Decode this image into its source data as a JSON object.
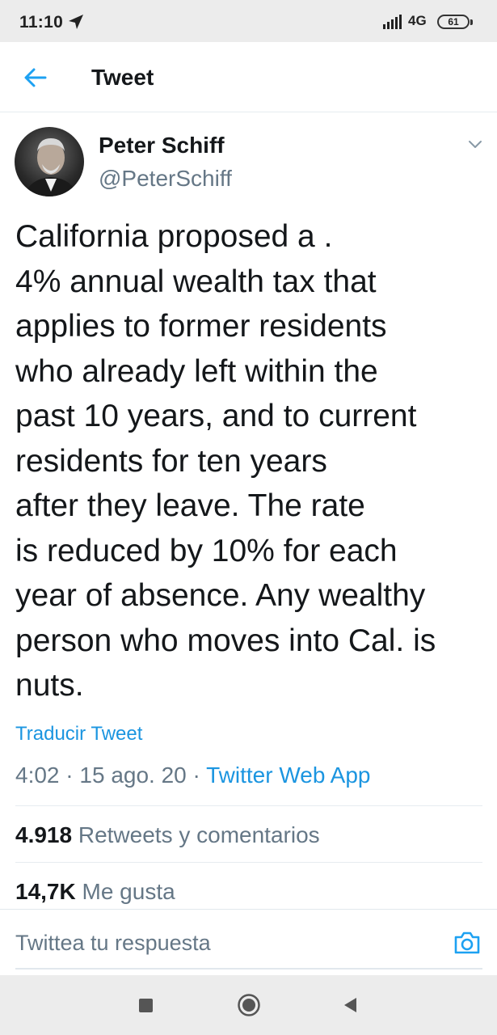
{
  "status_bar": {
    "time": "11:10",
    "network": "4G",
    "battery": "61"
  },
  "header": {
    "title": "Tweet"
  },
  "tweet": {
    "author_name": "Peter Schiff",
    "author_handle": "@PeterSchiff",
    "text_lines": [
      "California proposed a .",
      "4% annual wealth tax that",
      "applies to former residents",
      "who already left within the",
      "past 10 years, and to current",
      "residents for ten years",
      "after they leave. The rate",
      "is reduced by 10% for each",
      "year of absence. Any wealthy",
      "person who moves into Cal. is",
      "nuts."
    ],
    "translate_label": "Traducir Tweet",
    "time": "4:02",
    "date": "15 ago. 20",
    "separator": "·",
    "source": "Twitter Web App"
  },
  "stats": {
    "retweets_count": "4.918",
    "retweets_label": "Retweets y comentarios",
    "likes_count": "14,7K",
    "likes_label": "Me gusta"
  },
  "reply": {
    "placeholder": "Twittea tu respuesta"
  },
  "colors": {
    "accent": "#1b95e0",
    "text": "#14171a",
    "secondary": "#657786"
  },
  "icons": [
    "navigation-arrow-icon",
    "signal-icon",
    "back-arrow-icon",
    "chevron-down-icon",
    "camera-icon",
    "recent-apps-icon",
    "home-icon",
    "nav-back-icon"
  ]
}
